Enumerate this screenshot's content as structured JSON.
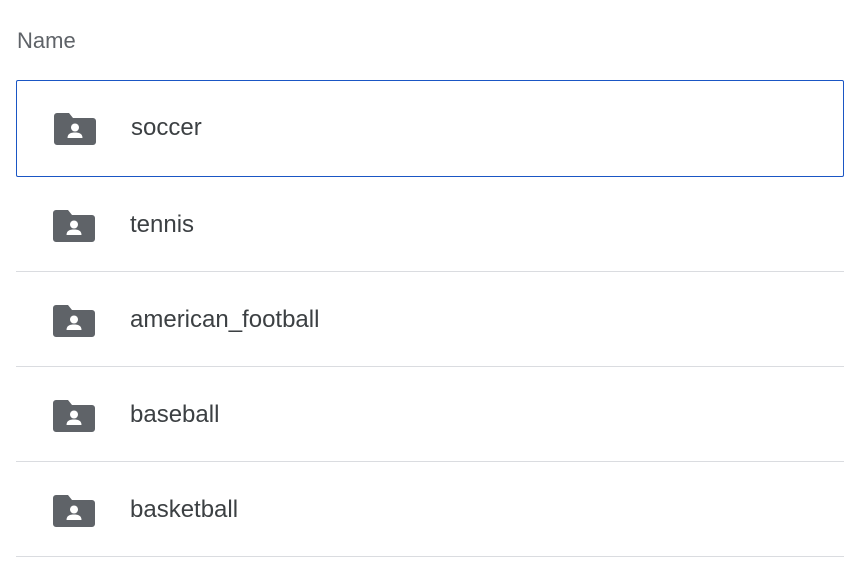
{
  "header": {
    "name_label": "Name"
  },
  "folders": [
    {
      "label": "soccer",
      "icon": "shared-folder-icon",
      "selected": true
    },
    {
      "label": "tennis",
      "icon": "shared-folder-icon",
      "selected": false
    },
    {
      "label": "american_football",
      "icon": "shared-folder-icon",
      "selected": false
    },
    {
      "label": "baseball",
      "icon": "shared-folder-icon",
      "selected": false
    },
    {
      "label": "basketball",
      "icon": "shared-folder-icon",
      "selected": false
    }
  ],
  "colors": {
    "icon": "#5f6368",
    "text": "#3c4043",
    "header": "#5f6368",
    "divider": "#dadce0",
    "selection": "#1a56c4"
  }
}
